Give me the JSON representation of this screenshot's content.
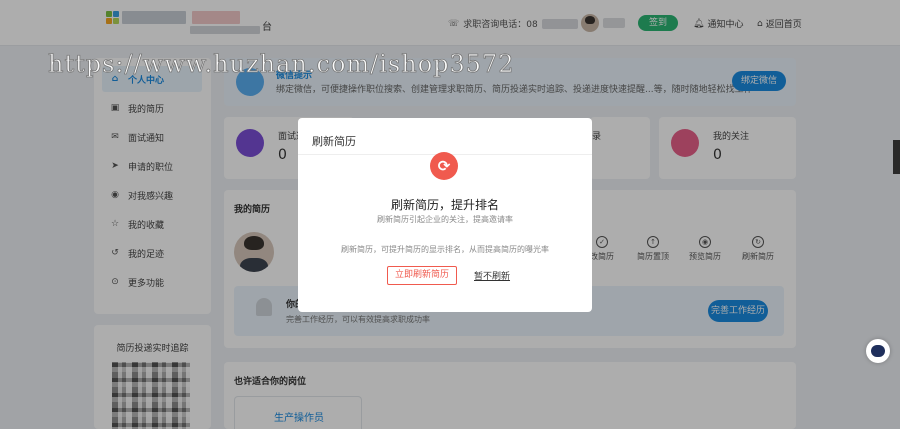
{
  "header": {
    "logo_suffix": "台",
    "hotline_label": "求职咨询电话：08",
    "signin_label": "签到",
    "notice_label": "通知中心",
    "home_label": "返回首页"
  },
  "sidebar": {
    "items": [
      {
        "label": "个人中心",
        "icon": "home-icon"
      },
      {
        "label": "我的简历",
        "icon": "briefcase-icon"
      },
      {
        "label": "面试通知",
        "icon": "mail-icon"
      },
      {
        "label": "申请的职位",
        "icon": "send-icon"
      },
      {
        "label": "对我感兴趣",
        "icon": "eye-icon"
      },
      {
        "label": "我的收藏",
        "icon": "star-icon"
      },
      {
        "label": "我的足迹",
        "icon": "history-icon"
      },
      {
        "label": "更多功能",
        "icon": "more-icon"
      }
    ],
    "qr_title": "简历投递实时追踪"
  },
  "banner": {
    "title": "微信提示",
    "desc": "绑定微信，可便捷操作职位搜索、创建管理求职简历、简历投递实时追踪、投递进度快速提醒...等，随时随地轻松找工作",
    "button": "绑定微信"
  },
  "stats": [
    {
      "label": "面试通",
      "value": "0",
      "color": "#7b4fd6"
    },
    {
      "label": "录",
      "value": "",
      "color": "#ffffff"
    },
    {
      "label": "我的关注",
      "value": "0",
      "color": "#e8608a"
    }
  ],
  "resume": {
    "heading": "我的简历",
    "actions": [
      "改简历",
      "简历置顶",
      "预览简历",
      "刷新简历"
    ],
    "perfect_title": "你的",
    "perfect_desc": "完善工作经历，可以有效提高求职成功率",
    "perfect_button": "完善工作经历"
  },
  "jobs": {
    "heading": "也许适合你的岗位",
    "items": [
      "生产操作员"
    ]
  },
  "watermark": "https://www.huzhan.com/ishop3572",
  "modal": {
    "title": "刷新简历",
    "headline": "刷新简历，提升排名",
    "subline": "刷新简历引起企业的关注，提高邀请率",
    "desc": "刷新简历，可提升简历的显示排名，从而提高简历的曝光率",
    "ok_button": "立即刷新简历",
    "later_link": "暂不刷新"
  },
  "colors": {
    "primary": "#1a8be0",
    "accent_red": "#f05a4e",
    "green": "#2bb673"
  }
}
